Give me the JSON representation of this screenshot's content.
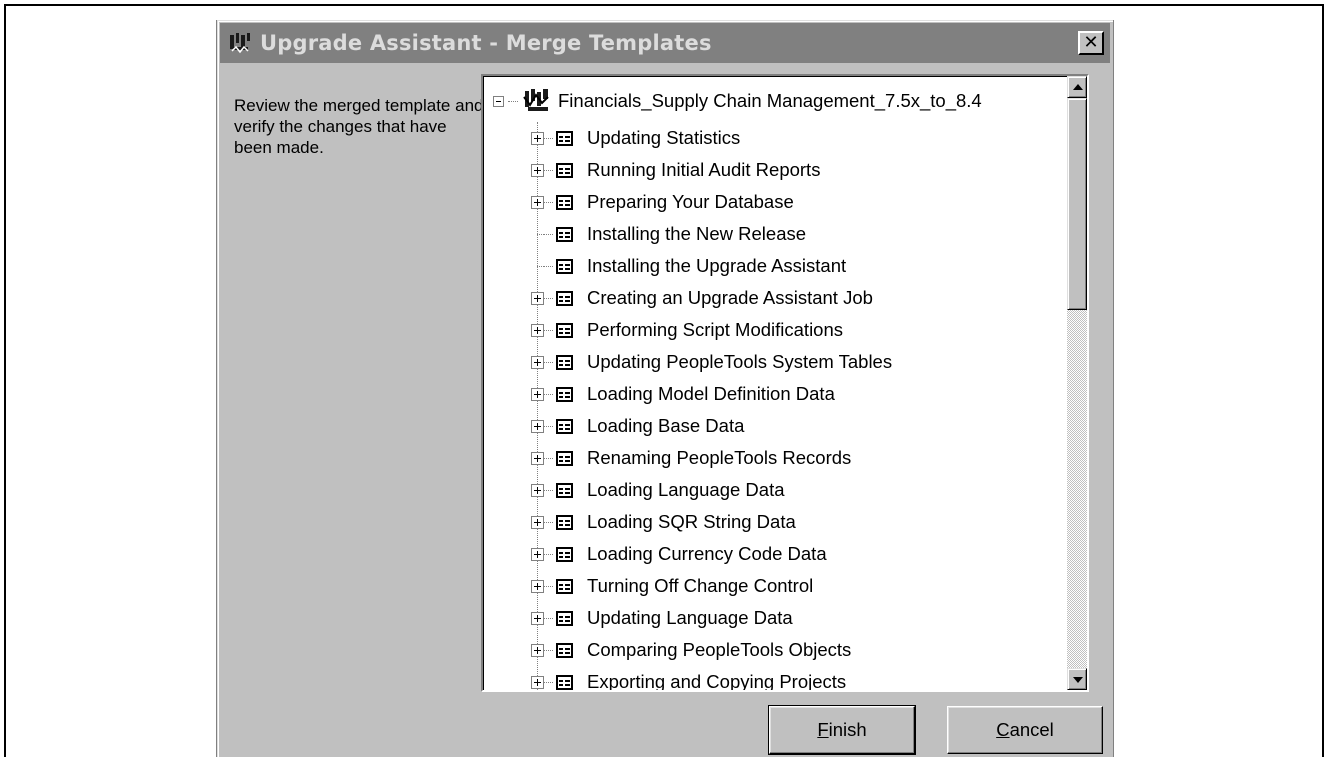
{
  "window": {
    "title": "Upgrade Assistant - Merge Templates",
    "close_glyph": "✕",
    "title_icon": "upgrade-assistant-icon"
  },
  "instructions": "Review the merged template and verify the changes that have been made.",
  "tree": {
    "root": {
      "label": "Financials_Supply Chain Management_7.5x_to_8.4",
      "icon": "template-icon",
      "expanded": true
    },
    "items": [
      {
        "label": "Updating Statistics",
        "expandable": true
      },
      {
        "label": "Running Initial Audit Reports",
        "expandable": true
      },
      {
        "label": "Preparing Your Database",
        "expandable": true
      },
      {
        "label": "Installing the New Release",
        "expandable": false
      },
      {
        "label": "Installing the Upgrade Assistant",
        "expandable": false
      },
      {
        "label": "Creating an Upgrade Assistant Job",
        "expandable": true
      },
      {
        "label": "Performing Script Modifications",
        "expandable": true
      },
      {
        "label": "Updating PeopleTools System Tables",
        "expandable": true
      },
      {
        "label": "Loading Model Definition Data",
        "expandable": true
      },
      {
        "label": "Loading Base Data",
        "expandable": true
      },
      {
        "label": "Renaming PeopleTools Records",
        "expandable": true
      },
      {
        "label": "Loading Language Data",
        "expandable": true
      },
      {
        "label": "Loading SQR String Data",
        "expandable": true
      },
      {
        "label": "Loading Currency Code Data",
        "expandable": true
      },
      {
        "label": "Turning Off Change Control",
        "expandable": true
      },
      {
        "label": "Updating Language Data",
        "expandable": true
      },
      {
        "label": "Comparing PeopleTools Objects",
        "expandable": true
      },
      {
        "label": "Exporting and Copying Projects",
        "expandable": true
      }
    ]
  },
  "buttons": {
    "finish": "Finish",
    "cancel": "Cancel"
  }
}
